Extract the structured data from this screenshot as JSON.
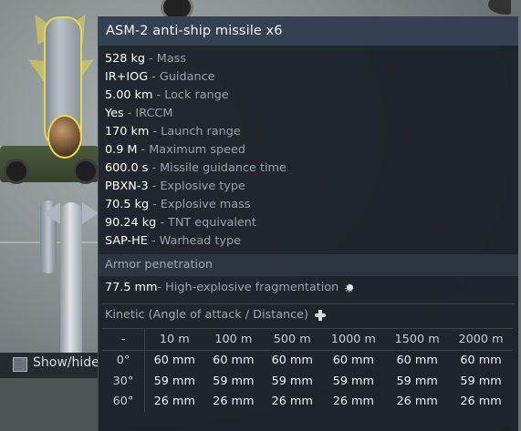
{
  "scene": {
    "show_hide_label": "Show/hide"
  },
  "tooltip": {
    "title": "ASM-2 anti-ship missile x6",
    "stats": [
      {
        "value": "528 kg",
        "label": " - Mass"
      },
      {
        "value": "IR+IOG",
        "label": " - Guidance"
      },
      {
        "value": "5.00 km",
        "label": " - Lock range"
      },
      {
        "value": "Yes",
        "label": " - IRCCM"
      },
      {
        "value": "170 km",
        "label": " - Launch range"
      },
      {
        "value": "0.9 M",
        "label": " - Maximum speed"
      },
      {
        "value": "600.0 s",
        "label": " - Missile guidance time"
      },
      {
        "value": "PBXN-3",
        "label": " - Explosive type"
      },
      {
        "value": "70.5 kg",
        "label": " - Explosive mass"
      },
      {
        "value": "90.24 kg",
        "label": " - TNT equivalent"
      },
      {
        "value": "SAP-HE",
        "label": " - Warhead type"
      }
    ],
    "armor_section_title": "Armor penetration",
    "fragmentation": {
      "value": "77.5 mm",
      "label": " - High-explosive fragmentation",
      "icon": "fragmentation-icon"
    },
    "kinetic_title": "Kinetic (Angle of attack / Distance)",
    "kinetic_icon": "kinetic-icon",
    "table": {
      "corner": "-",
      "distances": [
        "10 m",
        "100 m",
        "500 m",
        "1000 m",
        "1500 m",
        "2000 m"
      ],
      "rows": [
        {
          "angle": "0°",
          "values": [
            "60 mm",
            "60 mm",
            "60 mm",
            "60 mm",
            "60 mm",
            "60 mm"
          ]
        },
        {
          "angle": "30°",
          "values": [
            "59 mm",
            "59 mm",
            "59 mm",
            "59 mm",
            "59 mm",
            "59 mm"
          ]
        },
        {
          "angle": "60°",
          "values": [
            "26 mm",
            "26 mm",
            "26 mm",
            "26 mm",
            "26 mm",
            "26 mm"
          ]
        }
      ]
    }
  },
  "colors": {
    "panel_bg": "#1b2128",
    "title_bar": "#344152",
    "section_bg": "#2c3643",
    "label_gray": "#99a3ac",
    "highlight_yellow": "#e8d84a"
  }
}
